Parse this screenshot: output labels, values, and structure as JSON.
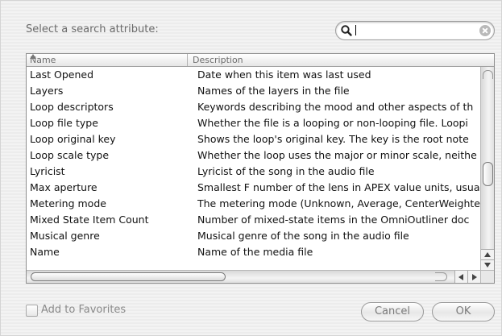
{
  "dialog": {
    "prompt": "Select a search attribute:",
    "search": {
      "value": "",
      "placeholder": ""
    },
    "columns": {
      "name": "Name",
      "description": "Description"
    },
    "rows": [
      {
        "name": "Last Opened",
        "description": "Date when this item was last used"
      },
      {
        "name": "Layers",
        "description": "Names of the layers in the file"
      },
      {
        "name": "Loop descriptors",
        "description": "Keywords describing the mood and other aspects of th"
      },
      {
        "name": "Loop file type",
        "description": "Whether the file is a looping or non-looping file. Loopi"
      },
      {
        "name": "Loop original key",
        "description": "Shows the loop's original key. The key is the root note"
      },
      {
        "name": "Loop scale type",
        "description": "Whether the loop uses the major or minor scale, neithe"
      },
      {
        "name": "Lyricist",
        "description": "Lyricist of the song in the audio file"
      },
      {
        "name": "Max aperture",
        "description": "Smallest F number of the lens in APEX value units, usua"
      },
      {
        "name": "Metering mode",
        "description": "The metering mode (Unknown, Average, CenterWeighte"
      },
      {
        "name": "Mixed State Item Count",
        "description": "Number of mixed-state items in the OmniOutliner doc"
      },
      {
        "name": "Musical genre",
        "description": "Musical genre of the song in the audio file"
      },
      {
        "name": "Name",
        "description": "Name of the media file"
      }
    ],
    "add_to_favorites": {
      "label": "Add to Favorites",
      "checked": false
    },
    "buttons": {
      "cancel": "Cancel",
      "ok": "OK"
    }
  }
}
